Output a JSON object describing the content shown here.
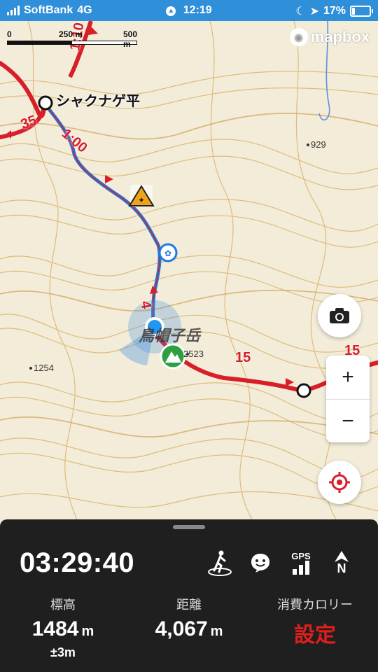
{
  "statusbar": {
    "carrier": "SoftBank",
    "network": "4G",
    "time": "12:19",
    "battery": "17%",
    "battery_level": 0.17
  },
  "map": {
    "scale": {
      "zero": "0",
      "mid": "250 m",
      "end": "500 m"
    },
    "logo": "mapbox",
    "place_labels": {
      "hut": "シャクナゲ平",
      "peak": "鳥帽子岳",
      "elev_peak": "2523",
      "elev_929": "929",
      "elev_1254": "1254"
    },
    "trail_labels": {
      "t1": "1:10",
      "t2": "1:00",
      "t3": "35",
      "t4": "15",
      "t5": "15",
      "t6": "4"
    }
  },
  "controls": {
    "zoom_in": "+",
    "zoom_out": "−"
  },
  "panel": {
    "elapsed_time": "03:29:40",
    "gps_label": "GPS",
    "north_label": "N",
    "elevation": {
      "label": "標高",
      "value": "1484",
      "unit": "m",
      "accuracy": "±3m"
    },
    "distance": {
      "label": "距離",
      "value": "4,067",
      "unit": "m"
    },
    "calories": {
      "label": "消費カロリー",
      "value": "設定"
    }
  },
  "colors": {
    "route_red": "#d81e28",
    "track_blue": "#1f7ae0",
    "contour": "#d9b46a",
    "panel_bg": "#1f1f1f"
  }
}
